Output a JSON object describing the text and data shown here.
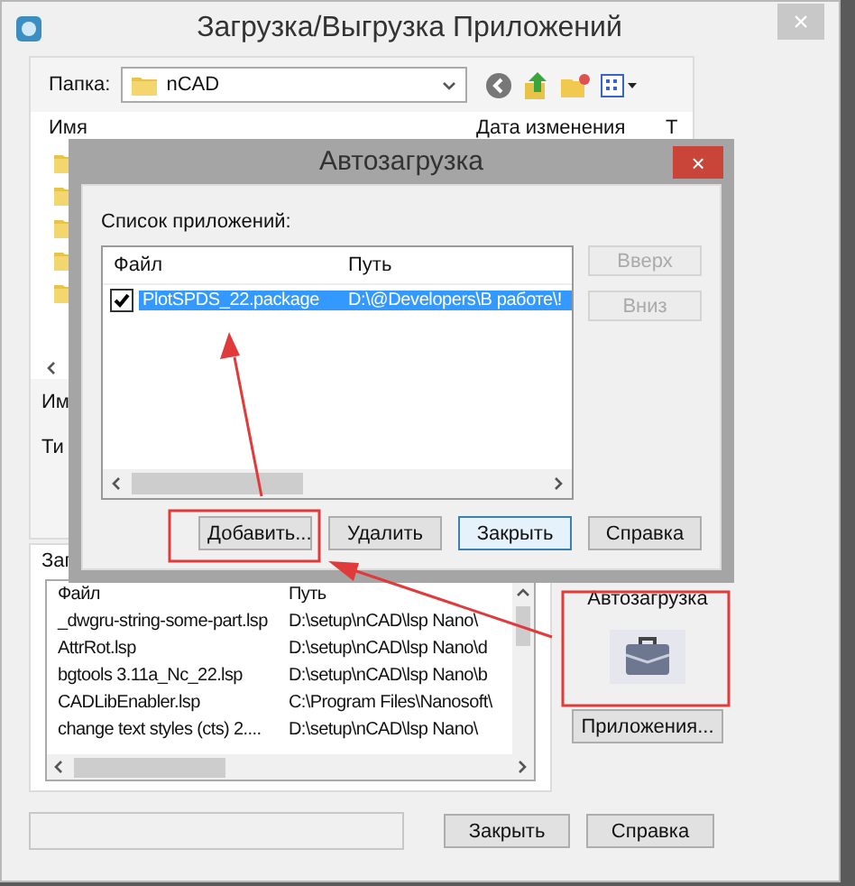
{
  "window": {
    "title": "Загрузка/Выгрузка Приложений",
    "close": "×"
  },
  "browser": {
    "folder_label": "Папка:",
    "folder": "nCAD",
    "columns": [
      "Имя",
      "Дата изменения",
      "Т"
    ],
    "name_label": "Им",
    "type_label": "Ти"
  },
  "loaded": {
    "tab": "Заг",
    "columns": [
      "Файл",
      "Путь"
    ],
    "rows": [
      {
        "file": "_dwgru-string-some-part.lsp",
        "path": "D:\\setup\\nCAD\\lsp Nano\\"
      },
      {
        "file": "AttrRot.lsp",
        "path": "D:\\setup\\nCAD\\lsp Nano\\d"
      },
      {
        "file": "bgtools 3.11a_Nc_22.lsp",
        "path": "D:\\setup\\nCAD\\lsp Nano\\b"
      },
      {
        "file": "CADLibEnabler.lsp",
        "path": "C:\\Program Files\\Nanosoft\\"
      },
      {
        "file": "change text styles (cts) 2....",
        "path": "D:\\setup\\nCAD\\lsp Nano\\"
      }
    ]
  },
  "startup": {
    "title": "Автозагрузка",
    "button": "Приложения..."
  },
  "buttons": [
    "Закрыть",
    "Справка"
  ],
  "dialog": {
    "title": "Автозагрузка",
    "close": "×",
    "list_label": "Список приложений:",
    "columns": [
      "Файл",
      "Путь"
    ],
    "rows": [
      {
        "file": "PlotSPDS_22.package",
        "path": "D:\\@Developers\\В работе\\!",
        "checked": true,
        "selected": true
      }
    ],
    "side_buttons": [
      {
        "label": "Вверх",
        "disabled": true
      },
      {
        "label": "Вниз",
        "disabled": true
      }
    ],
    "buttons": [
      {
        "label": "Добавить...",
        "default": false
      },
      {
        "label": "Удалить",
        "default": false
      },
      {
        "label": "Закрыть",
        "default": true
      },
      {
        "label": "Справка",
        "default": false
      }
    ]
  }
}
